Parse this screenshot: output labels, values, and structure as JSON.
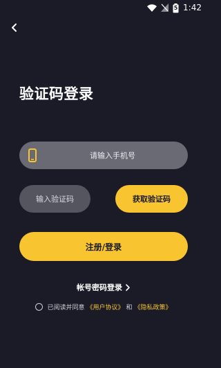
{
  "status_bar": {
    "time": "1:42",
    "battery_text": "5"
  },
  "page": {
    "title": "验证码登录"
  },
  "phone_field": {
    "placeholder": "请输入手机号",
    "value": ""
  },
  "code_field": {
    "placeholder": "输入验证码",
    "value": ""
  },
  "buttons": {
    "get_code": "获取验证码",
    "submit": "注册/登录"
  },
  "alt_login": {
    "label": "帐号密码登录"
  },
  "agreement": {
    "prefix": "已阅读并同意",
    "user_agreement": "《用户协议》",
    "conjunction": "和",
    "privacy_policy": "《隐私政策》",
    "checked": false
  },
  "colors": {
    "background": "#1b1b27",
    "accent": "#f8c430",
    "field": "#6a6a74"
  }
}
